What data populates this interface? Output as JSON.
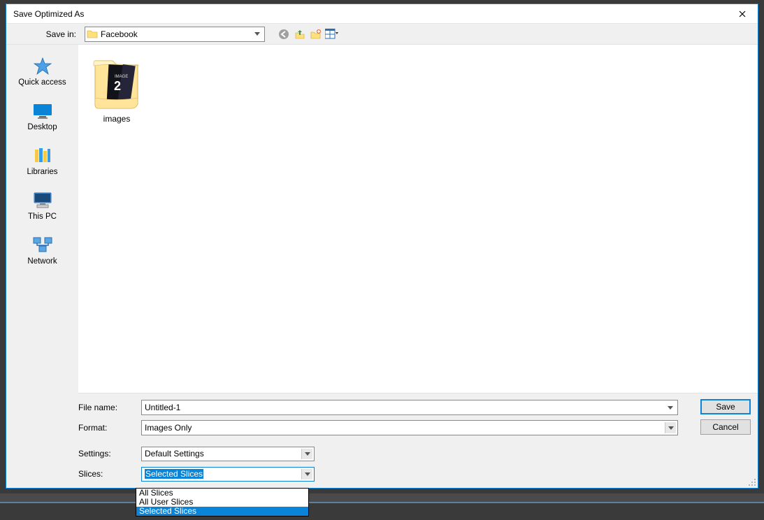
{
  "titlebar": {
    "title": "Save Optimized As"
  },
  "toolbar": {
    "savein_label": "Save in:",
    "savein_value": "Facebook"
  },
  "places": [
    {
      "id": "quickaccess",
      "label": "Quick access"
    },
    {
      "id": "desktop",
      "label": "Desktop"
    },
    {
      "id": "libraries",
      "label": "Libraries"
    },
    {
      "id": "thispc",
      "label": "This PC"
    },
    {
      "id": "network",
      "label": "Network"
    }
  ],
  "fileArea": {
    "items": [
      {
        "name": "images",
        "badge": "2"
      }
    ]
  },
  "bottom": {
    "filename_label": "File name:",
    "filename_value": "Untitled-1",
    "format_label": "Format:",
    "format_value": "Images Only",
    "settings_label": "Settings:",
    "settings_value": "Default Settings",
    "slices_label": "Slices:",
    "slices_value": "Selected Slices",
    "slices_options": [
      "All Slices",
      "All User Slices",
      "Selected Slices"
    ],
    "save_btn": "Save",
    "cancel_btn": "Cancel"
  }
}
